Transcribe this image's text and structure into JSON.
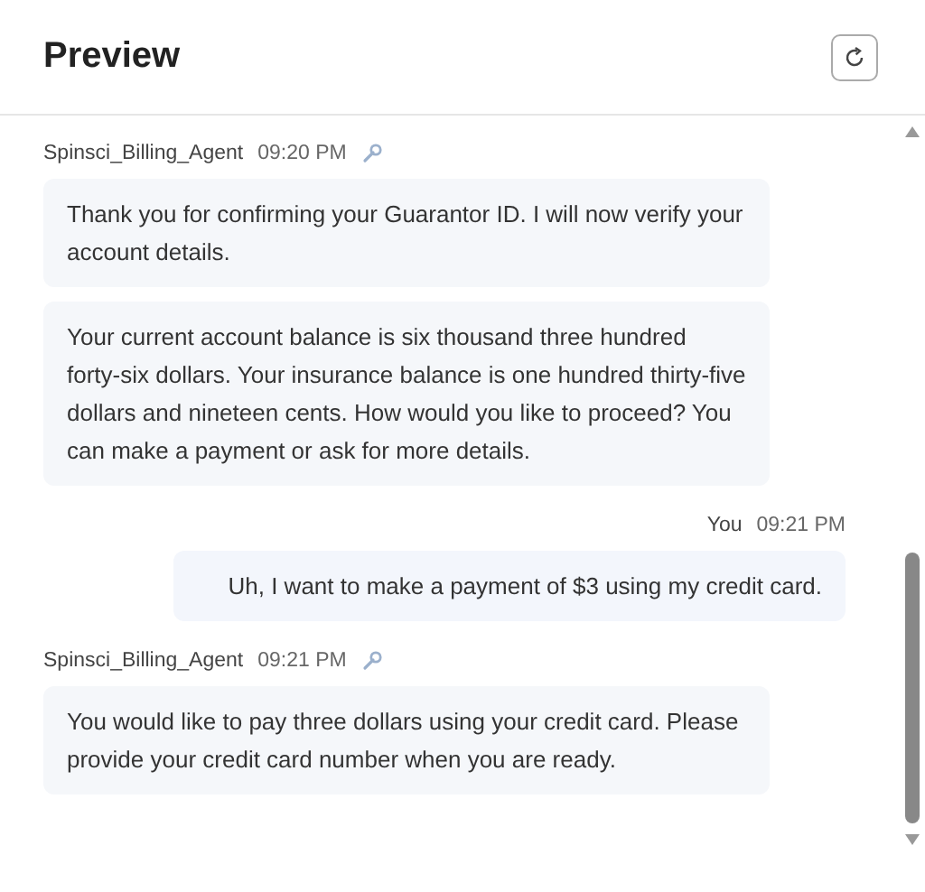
{
  "header": {
    "title": "Preview"
  },
  "messages": [
    {
      "kind": "agent",
      "sender": "Spinsci_Billing_Agent",
      "time": "09:20 PM",
      "bubbles": [
        "Thank you for confirming your Guarantor ID. I will now verify your account details.",
        "Your current account balance is six thousand three hundred forty-six dollars. Your insurance balance is one hundred thirty-five dollars and nineteen cents. How would you like to proceed? You can make a payment or ask for more details."
      ]
    },
    {
      "kind": "user",
      "sender": "You",
      "time": "09:21 PM",
      "bubbles": [
        "Uh, I want to make a payment of $3 using my credit card."
      ]
    },
    {
      "kind": "agent",
      "sender": "Spinsci_Billing_Agent",
      "time": "09:21 PM",
      "bubbles": [
        "You would like to pay three dollars using your credit card. Please provide your credit card number when you are ready."
      ]
    }
  ]
}
